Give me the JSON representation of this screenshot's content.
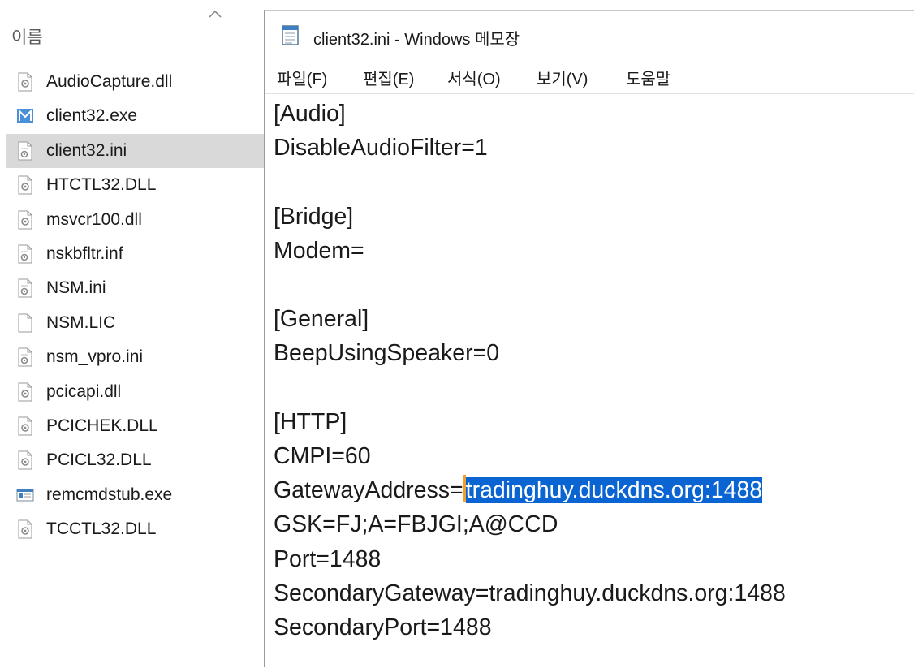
{
  "explorer": {
    "column_header": "이름",
    "files": [
      {
        "name": "AudioCapture.dll",
        "icon": "dll-file-icon"
      },
      {
        "name": "client32.exe",
        "icon": "exe-app-icon"
      },
      {
        "name": "client32.ini",
        "icon": "ini-settings-file-icon",
        "selected": true
      },
      {
        "name": "HTCTL32.DLL",
        "icon": "dll-file-icon"
      },
      {
        "name": "msvcr100.dll",
        "icon": "dll-file-icon"
      },
      {
        "name": "nskbfltr.inf",
        "icon": "ini-settings-file-icon"
      },
      {
        "name": "NSM.ini",
        "icon": "ini-settings-file-icon"
      },
      {
        "name": "NSM.LIC",
        "icon": "blank-file-icon"
      },
      {
        "name": "nsm_vpro.ini",
        "icon": "ini-settings-file-icon"
      },
      {
        "name": "pcicapi.dll",
        "icon": "dll-file-icon"
      },
      {
        "name": "PCICHEK.DLL",
        "icon": "dll-file-icon"
      },
      {
        "name": "PCICL32.DLL",
        "icon": "dll-file-icon"
      },
      {
        "name": "remcmdstub.exe",
        "icon": "console-exe-icon"
      },
      {
        "name": "TCCTL32.DLL",
        "icon": "dll-file-icon"
      }
    ]
  },
  "notepad": {
    "title": "client32.ini - Windows 메모장",
    "menu": [
      "파일(F)",
      "편집(E)",
      "서식(O)",
      "보기(V)",
      "도움말"
    ],
    "lines": [
      "[Audio]",
      "DisableAudioFilter=1",
      "",
      "[Bridge]",
      "Modem=",
      "",
      "[General]",
      "BeepUsingSpeaker=0",
      "",
      "[HTTP]",
      "CMPI=60",
      "GatewayAddress=",
      "GSK=FJ;A=FBJGI;A@CCD",
      "Port=1488",
      "SecondaryGateway=tradinghuy.duckdns.org:1488",
      "SecondaryPort=1488"
    ],
    "selected_text": "tradinghuy.duckdns.org:1488",
    "selection_color": "#0a64d2"
  }
}
